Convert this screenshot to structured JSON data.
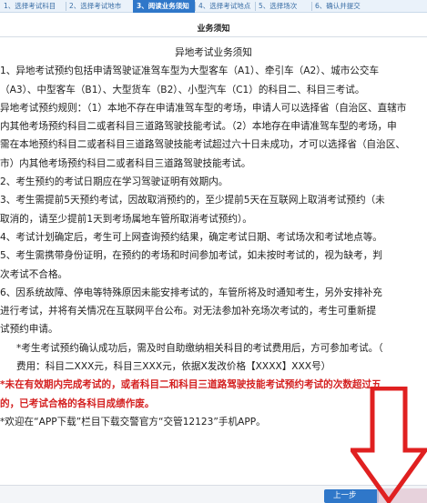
{
  "steps": [
    "1、选择考试科目",
    "2、选择考试地市",
    "3、阅读业务须知",
    "4、选择考试地点",
    "5、选择场次",
    "6、确认并提交"
  ],
  "panel": {
    "title": "业务须知",
    "heading": "异地考试业务须知"
  },
  "lines": [
    "1、异地考试预约包括申请驾驶证准驾车型为大型客车（A1）、牵引车（A2）、城市公交车",
    "（A3）、中型客车（B1）、大型货车（B2）、小型汽车（C1）的科目二、科目三考试。",
    "异地考试预约规则：（1）本地不存在申请准驾车型的考场，申请人可以选择省（自治区、直辖市",
    "内其他考场预约科目二或者科目三道路驾驶技能考试。（2）本地存在申请准驾车型的考场，申",
    "需在本地预约科目二或者科目三道路驾驶技能考试超过六十日未成功，才可以选择省（自治区、",
    "市）内其他考场预约科目二或者科目三道路驾驶技能考试。",
    "2、考生预约的考试日期应在学习驾驶证明有效期内。",
    "3、考生需提前5天预约考试，因故取消预约的，至少提前5天在互联网上取消考试预约（未",
    "取消的，请至少提前1天到考场属地车管所取消考试预约）。",
    "4、考试计划确定后，考生可上网查询预约结果，确定考试日期、考试场次和考试地点等。",
    "5、考生需携带身份证明，在预约的考场和时间参加考试，如未按时考试的，视为缺考，判",
    "次考试不合格。",
    "6、因系统故障、停电等特殊原因未能安排考试的，车管所将及时通知考生，另外安排补充",
    "进行考试，并将有关情况在互联网平台公布。对无法参加补充场次考试的，考生可重新提",
    "试预约申请。",
    "*考生考试预约确认成功后，需及时自助缴纳相关科目的考试费用后，方可参加考试。（",
    "费用：科目二XXX元，科目三XXX元，依据X发改价格【XXXX】XXX号）"
  ],
  "warning": [
    "*未在有效期内完成考试的，或者科目二和科目三道路驾驶技能考试预约考试的次数超过五",
    "的，已考试合格的各科目成绩作废。"
  ],
  "footer_note": "*欢迎在“APP下载”栏目下载交警官方“交管12123”手机APP。",
  "buttons": {
    "prev": "上一步"
  },
  "colors": {
    "active_step": "#2f77c9",
    "warning_text": "#d42020",
    "arrow": "#e02020"
  }
}
